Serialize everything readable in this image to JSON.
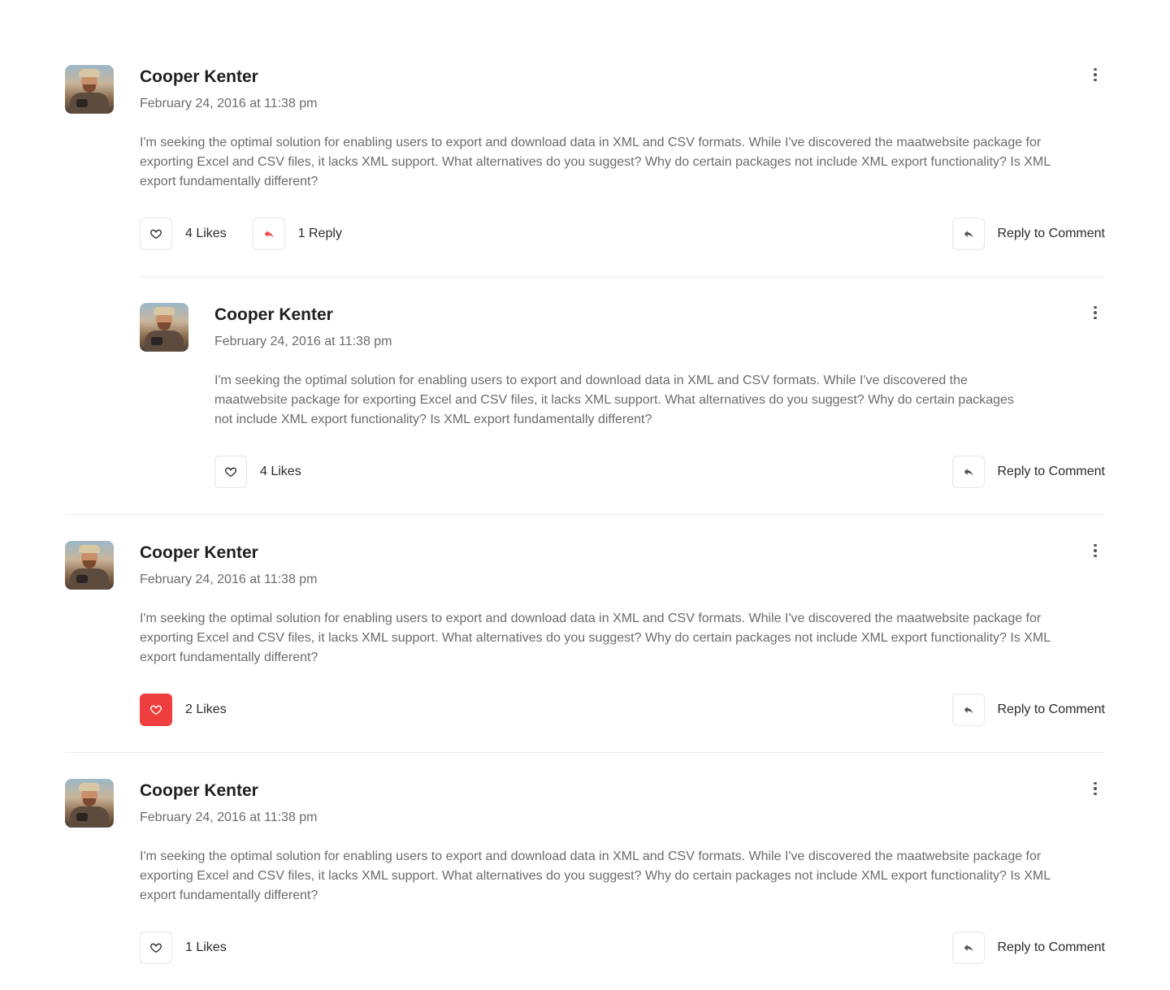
{
  "colors": {
    "accent": "#ef3e3e",
    "text_muted": "#6b6b70",
    "border": "#e6e6e8"
  },
  "threads": [
    {
      "comment": {
        "author": "Cooper Kenter",
        "date": "February 24, 2016 at 11:38 pm",
        "text": "I'm seeking the optimal solution for enabling users to export and download data in XML and CSV formats. While I've discovered the maatwebsite package for exporting Excel and CSV files, it lacks XML support. What alternatives do you suggest? Why do certain packages not include XML export functionality? Is XML export fundamentally different?",
        "likes_label": "4 Likes",
        "liked": false,
        "replies_label": "1 Reply",
        "reply_action_label": "Reply to Comment"
      },
      "reply": {
        "author": "Cooper Kenter",
        "date": "February 24, 2016 at 11:38 pm",
        "text": "I'm seeking the optimal solution for enabling users to export and download data in XML and CSV formats. While I've discovered the maatwebsite package for exporting Excel and CSV files, it lacks XML support. What alternatives do you suggest? Why do certain packages not include XML export functionality? Is XML export fundamentally different?",
        "likes_label": "4 Likes",
        "liked": false,
        "reply_action_label": "Reply to Comment"
      }
    },
    {
      "comment": {
        "author": "Cooper Kenter",
        "date": "February 24, 2016 at 11:38 pm",
        "text": "I'm seeking the optimal solution for enabling users to export and download data in XML and CSV formats. While I've discovered the maatwebsite package for exporting Excel and CSV files, it lacks XML support. What alternatives do you suggest? Why do certain packages not include XML export functionality? Is XML export fundamentally different?",
        "likes_label": "2 Likes",
        "liked": true,
        "reply_action_label": "Reply to Comment"
      }
    },
    {
      "comment": {
        "author": "Cooper Kenter",
        "date": "February 24, 2016 at 11:38 pm",
        "text": "I'm seeking the optimal solution for enabling users to export and download data in XML and CSV formats. While I've discovered the maatwebsite package for exporting Excel and CSV files, it lacks XML support. What alternatives do you suggest? Why do certain packages not include XML export functionality? Is XML export fundamentally different?",
        "likes_label": "1 Likes",
        "liked": false,
        "reply_action_label": "Reply to Comment"
      }
    }
  ],
  "icons": {
    "like": "heart-icon",
    "replies": "reply-arrow-icon",
    "reply_action": "reply-arrow-icon",
    "more": "more-vertical-icon"
  }
}
